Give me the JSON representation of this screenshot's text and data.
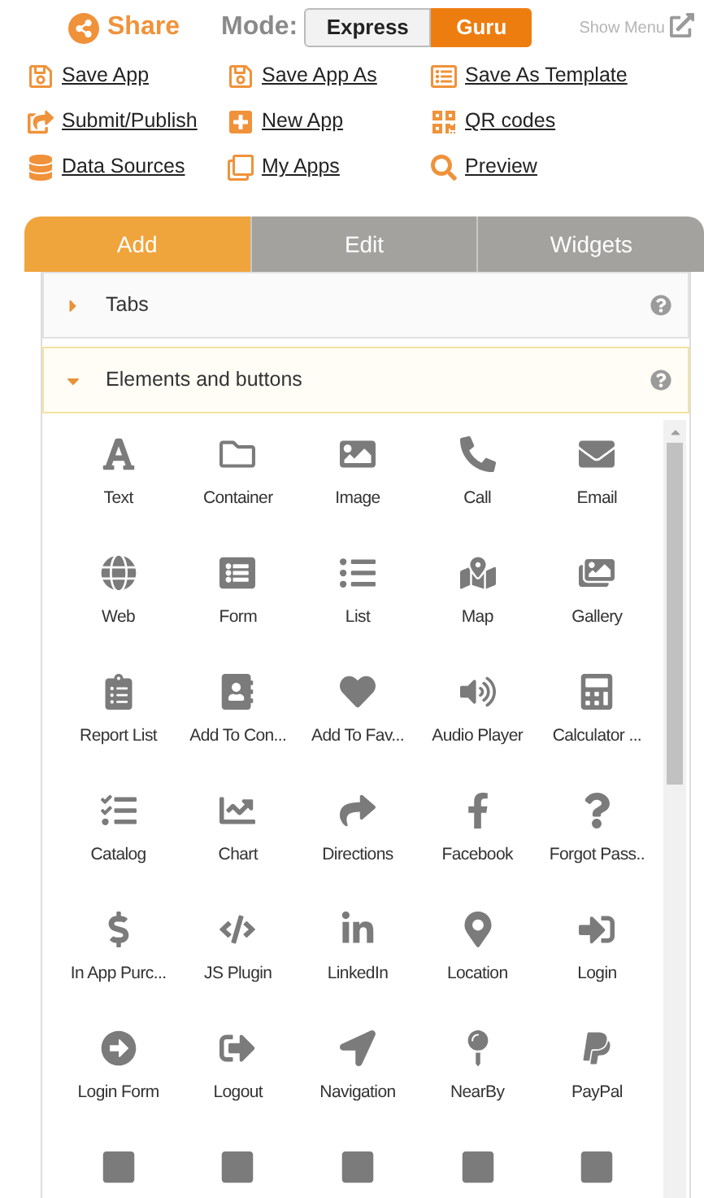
{
  "header": {
    "share": "Share",
    "mode_label": "Mode:",
    "modes": [
      {
        "label": "Express",
        "selected": false
      },
      {
        "label": "Guru",
        "selected": true
      }
    ],
    "show_menu": "Show Menu"
  },
  "actions": [
    {
      "label": "Save App"
    },
    {
      "label": "Save App As"
    },
    {
      "label": "Save As Template"
    },
    {
      "label": "Submit/Publish"
    },
    {
      "label": "New App"
    },
    {
      "label": "QR codes"
    },
    {
      "label": "Data Sources"
    },
    {
      "label": "My Apps"
    },
    {
      "label": "Preview"
    }
  ],
  "tabs": [
    {
      "label": "Add",
      "selected": true
    },
    {
      "label": "Edit",
      "selected": false
    },
    {
      "label": "Widgets",
      "selected": false
    }
  ],
  "sections": [
    {
      "title": "Tabs",
      "expanded": false
    },
    {
      "title": "Elements and buttons",
      "expanded": true
    }
  ],
  "elements": [
    {
      "label": "Text"
    },
    {
      "label": "Container"
    },
    {
      "label": "Image"
    },
    {
      "label": "Call"
    },
    {
      "label": "Email"
    },
    {
      "label": "Web"
    },
    {
      "label": "Form"
    },
    {
      "label": "List"
    },
    {
      "label": "Map"
    },
    {
      "label": "Gallery"
    },
    {
      "label": "Report List"
    },
    {
      "label": "Add To Con..."
    },
    {
      "label": "Add To Fav..."
    },
    {
      "label": "Audio Player"
    },
    {
      "label": "Calculator ..."
    },
    {
      "label": "Catalog"
    },
    {
      "label": "Chart"
    },
    {
      "label": "Directions"
    },
    {
      "label": "Facebook"
    },
    {
      "label": "Forgot Pass.."
    },
    {
      "label": "In App Purc..."
    },
    {
      "label": "JS Plugin"
    },
    {
      "label": "LinkedIn"
    },
    {
      "label": "Location"
    },
    {
      "label": "Login"
    },
    {
      "label": "Login Form"
    },
    {
      "label": "Logout"
    },
    {
      "label": "Navigation"
    },
    {
      "label": "NearBy"
    },
    {
      "label": "PayPal"
    }
  ]
}
